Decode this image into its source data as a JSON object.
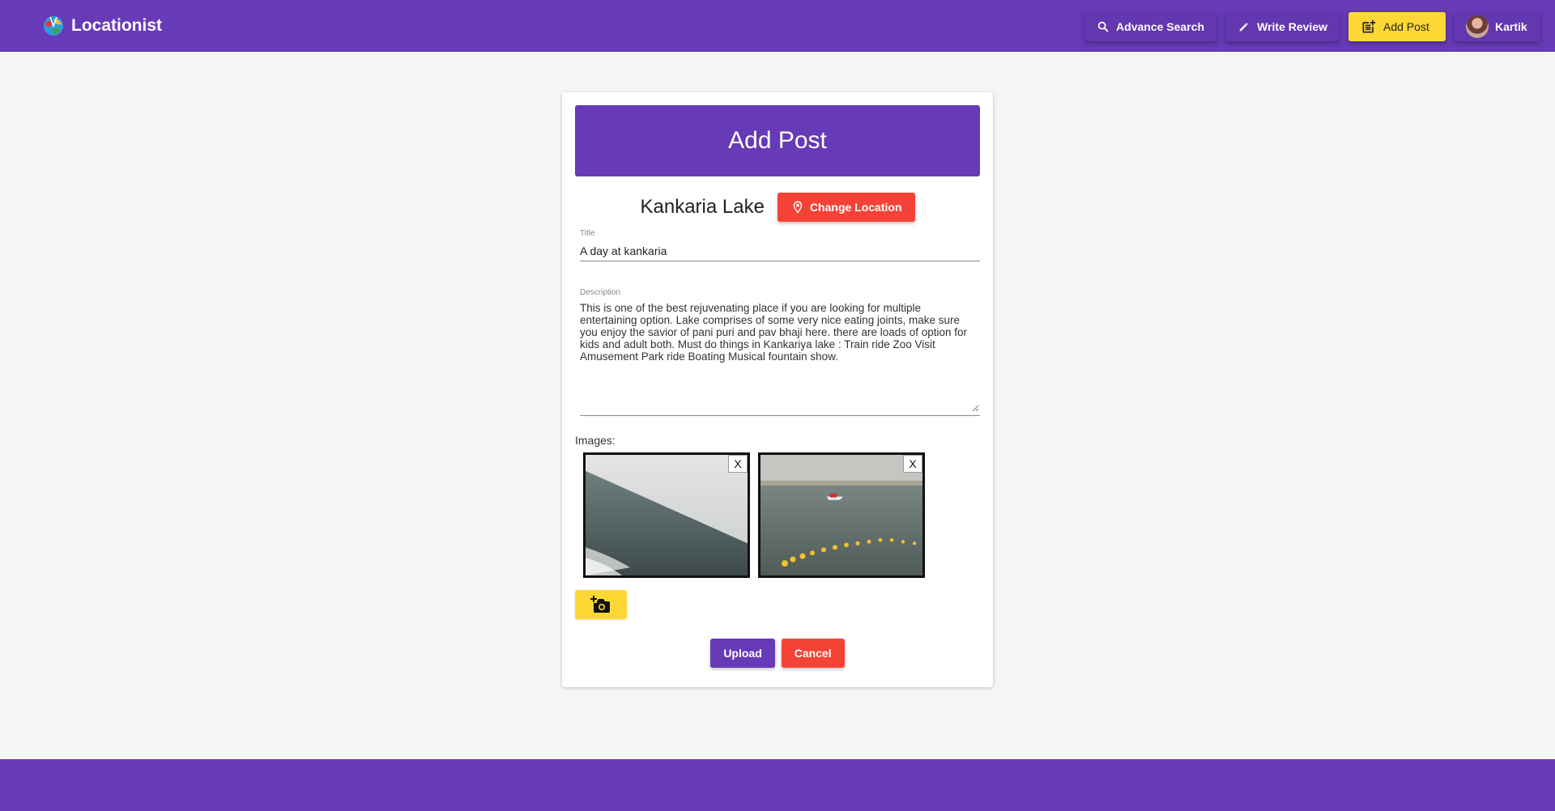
{
  "app": {
    "name": "Locationist",
    "colors": {
      "primary": "#673ab7",
      "accent": "#fdd835",
      "danger": "#f44336"
    }
  },
  "nav": {
    "advance_search": "Advance Search",
    "write_review": "Write Review",
    "add_post": "Add Post",
    "user_name": "Kartik"
  },
  "form": {
    "header": "Add Post",
    "location_name": "Kankaria Lake",
    "change_location_label": "Change Location",
    "title_label": "Title",
    "title_value": "A day at kankaria",
    "description_label": "Description",
    "description_value": "This is one of the best rejuvenating place if you are looking for multiple entertaining option. Lake comprises of some very nice eating joints, make sure you enjoy the savior of pani puri and pav bhaji here. there are loads of option for kids and adult both. Must do things in Kankariya lake : Train ride Zoo Visit Amusement Park ride Boating Musical fountain show.",
    "images_label": "Images:",
    "images": [
      {
        "remove_label": "X",
        "icon": "lake-photo-1"
      },
      {
        "remove_label": "X",
        "icon": "lake-photo-2"
      }
    ],
    "add_image_icon": "add-a-photo-icon",
    "upload_label": "Upload",
    "cancel_label": "Cancel"
  }
}
